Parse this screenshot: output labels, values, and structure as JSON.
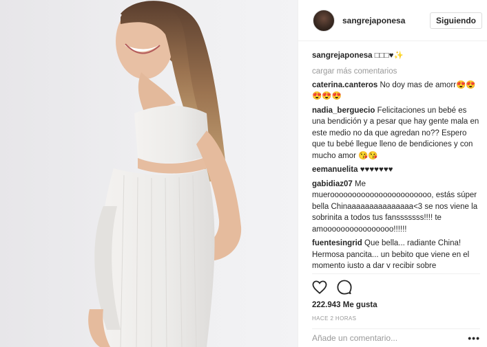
{
  "post": {
    "username": "sangrejaponesa",
    "follow_label": "Siguiendo"
  },
  "caption": {
    "user": "sangrejaponesa",
    "text": "□□□♥✨"
  },
  "load_more": "cargar más comentarios",
  "comments": [
    {
      "user": "caterina.canteros",
      "text": "No doy mas de amorr😍😍😍😍😍"
    },
    {
      "user": "nadia_berguecio",
      "text": "Felicitaciones un bebé es una bendición y a pesar que hay gente mala en este medio no da que agredan no?? Espero que tu bebé llegue lleno de bendiciones y con mucho amor 😘😘"
    },
    {
      "user": "eemanuelita",
      "text": "♥♥♥♥♥♥♥"
    },
    {
      "user": "gabidiaz07",
      "text": "Me muerooooooooooooooooooooooo, estás súper bella Chinaaaaaaaaaaaaaaa<3 se nos viene la sobrinita a todos tus fansssssss!!!! te amoooooooooooooooo!!!!!!"
    },
    {
      "user": "fuentesingrid",
      "text": "Que bella... radiante China! Hermosa pancita... un bebito que viene en el momento justo a dar y recibir sobre"
    }
  ],
  "likes": "222.943 Me gusta",
  "time": "HACE 2 HORAS",
  "comment_placeholder": "Añade un comentario...",
  "more_options": "•••"
}
